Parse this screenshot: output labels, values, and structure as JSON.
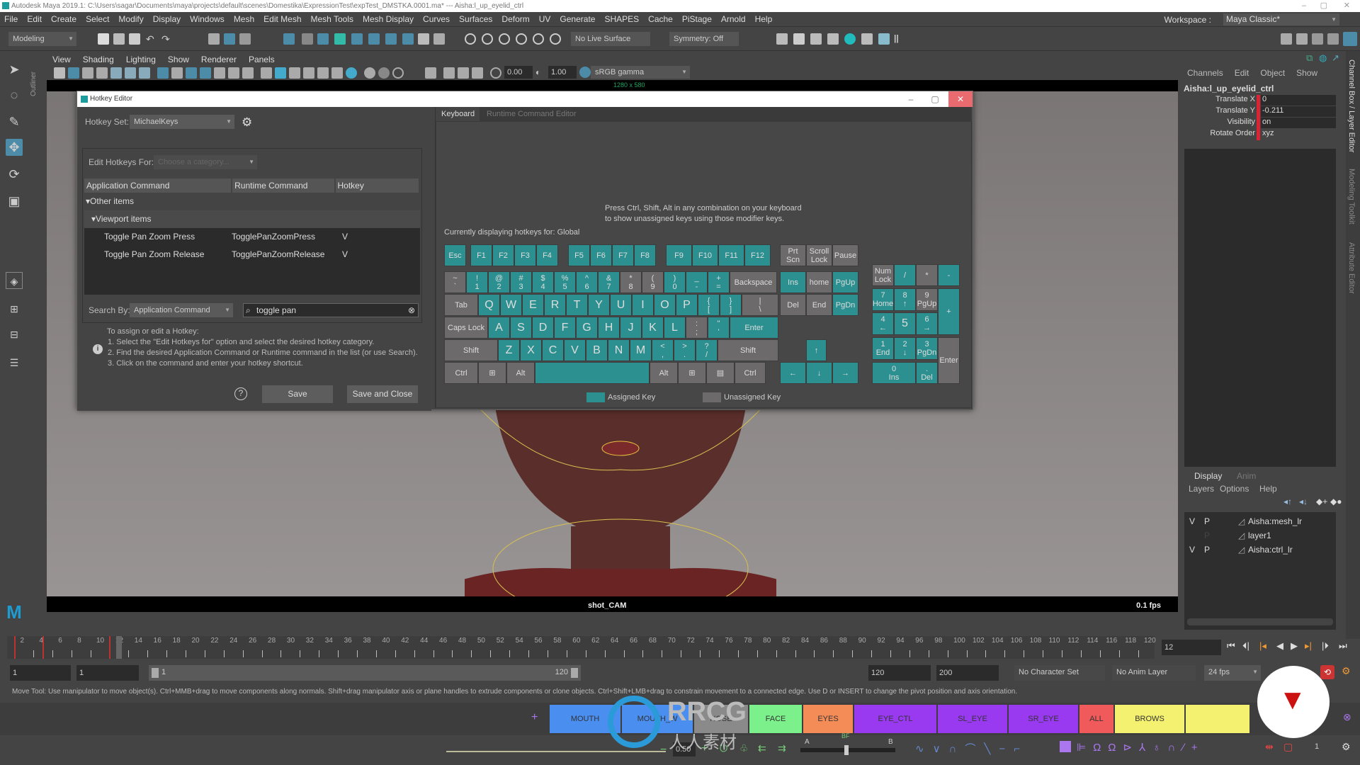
{
  "window": {
    "title": "Autodesk Maya 2019.1: C:\\Users\\sagar\\Documents\\maya\\projects\\default\\scenes\\Domestika\\ExpressionTest\\expTest_DMSTKA.0001.ma*   ---   Aisha:l_up_eyelid_ctrl",
    "controls": {
      "minimize": "–",
      "maximize": "▢",
      "close": "✕"
    }
  },
  "menubar": [
    "File",
    "Edit",
    "Create",
    "Select",
    "Modify",
    "Display",
    "Windows",
    "Mesh",
    "Edit Mesh",
    "Mesh Tools",
    "Mesh Display",
    "Curves",
    "Surfaces",
    "Deform",
    "UV",
    "Generate",
    "SHAPES",
    "Cache",
    "PiStage",
    "Arnold",
    "Help"
  ],
  "workspace": {
    "label": "Workspace :",
    "value": "Maya Classic*"
  },
  "status_line": {
    "menu_set": "Modeling",
    "live_surface": "No Live Surface",
    "symmetry": "Symmetry: Off"
  },
  "outliner_tab": "Outliner",
  "viewport": {
    "menu": [
      "View",
      "Shading",
      "Lighting",
      "Show",
      "Renderer",
      "Panels"
    ],
    "exposure": "0.00",
    "gamma": "1.00",
    "color_space": "sRGB gamma",
    "resolution": "1280 x 580",
    "camera": "shot_CAM",
    "fps": "0.1 fps"
  },
  "hotkey_editor": {
    "title": "Hotkey Editor",
    "hotkey_set_label": "Hotkey Set:",
    "hotkey_set_value": "MichaelKeys",
    "edit_for_label": "Edit Hotkeys For:",
    "edit_for_placeholder": "Choose a category...",
    "columns": [
      "Application Command",
      "Runtime Command",
      "Hotkey"
    ],
    "groups": [
      "Other items",
      "Viewport items"
    ],
    "rows": [
      {
        "app": "Toggle Pan Zoom Press",
        "runtime": "TogglePanZoomPress",
        "hotkey": "V"
      },
      {
        "app": "Toggle Pan Zoom Release",
        "runtime": "TogglePanZoomRelease",
        "hotkey": "V"
      }
    ],
    "search_by_label": "Search By:",
    "search_by_value": "Application Command",
    "search_text": "toggle pan",
    "info": [
      "To assign or edit a Hotkey:",
      "1. Select the \"Edit Hotkeys for\" option and select the desired hotkey category.",
      "2. Find the desired Application Command or Runtime command in the list (or use Search).",
      "3. Click on the command and enter your hotkey shortcut."
    ],
    "help": "?",
    "save": "Save",
    "save_close": "Save and Close",
    "tabs": [
      "Keyboard",
      "Runtime Command Editor"
    ],
    "hint": [
      "Press Ctrl, Shift, Alt in any combination on your keyboard",
      "to show unassigned keys using those modifier keys."
    ],
    "current": "Currently displaying hotkeys for: Global",
    "legend_assigned": "Assigned Key",
    "legend_unassigned": "Unassigned Key",
    "colors": {
      "assigned": "#2c9090",
      "unassigned": "#6c6a6a"
    }
  },
  "keyboard": {
    "rows": [
      [
        [
          "Esc",
          "a"
        ],
        [
          "F1",
          "a"
        ],
        [
          "F2",
          "a"
        ],
        [
          "F3",
          "a"
        ],
        [
          "F4",
          "a"
        ],
        [
          "F5",
          "a"
        ],
        [
          "F6",
          "a"
        ],
        [
          "F7",
          "a"
        ],
        [
          "F8",
          "a"
        ],
        [
          "F9",
          "a"
        ],
        [
          "F10",
          "a"
        ],
        [
          "F11",
          "a"
        ],
        [
          "F12",
          "a"
        ]
      ],
      [
        [
          "~\n`",
          "u"
        ],
        [
          "!\n1",
          "a"
        ],
        [
          "@\n2",
          "a"
        ],
        [
          "#\n3",
          "a"
        ],
        [
          "$\n4",
          "a"
        ],
        [
          "%\n5",
          "a"
        ],
        [
          "^\n6",
          "a"
        ],
        [
          "&\n7",
          "a"
        ],
        [
          "*\n8",
          "u"
        ],
        [
          "(\n9",
          "u"
        ],
        [
          ")\n0",
          "a"
        ],
        [
          "_\n-",
          "a"
        ],
        [
          "+\n=",
          "a"
        ],
        [
          "Backspace",
          "u"
        ]
      ],
      [
        [
          "Tab",
          "u"
        ],
        [
          "Q",
          "a"
        ],
        [
          "W",
          "a"
        ],
        [
          "E",
          "a"
        ],
        [
          "R",
          "a"
        ],
        [
          "T",
          "a"
        ],
        [
          "Y",
          "a"
        ],
        [
          "U",
          "a"
        ],
        [
          "I",
          "a"
        ],
        [
          "O",
          "a"
        ],
        [
          "P",
          "a"
        ],
        [
          "{\n[",
          "a"
        ],
        [
          "}\n]",
          "a"
        ],
        [
          "|\n\\",
          "u"
        ]
      ],
      [
        [
          "Caps Lock",
          "u"
        ],
        [
          "A",
          "a"
        ],
        [
          "S",
          "a"
        ],
        [
          "D",
          "a"
        ],
        [
          "F",
          "a"
        ],
        [
          "G",
          "a"
        ],
        [
          "H",
          "a"
        ],
        [
          "J",
          "a"
        ],
        [
          "K",
          "a"
        ],
        [
          "L",
          "a"
        ],
        [
          ":\n;",
          "u"
        ],
        [
          "\"\n'",
          "a"
        ],
        [
          "Enter",
          "a"
        ]
      ],
      [
        [
          "Shift",
          "u"
        ],
        [
          "Z",
          "a"
        ],
        [
          "X",
          "a"
        ],
        [
          "C",
          "a"
        ],
        [
          "V",
          "a"
        ],
        [
          "B",
          "a"
        ],
        [
          "N",
          "a"
        ],
        [
          "M",
          "a"
        ],
        [
          "<\n,",
          "a"
        ],
        [
          ">\n.",
          "a"
        ],
        [
          "?\n/",
          "a"
        ],
        [
          "Shift",
          "u"
        ]
      ],
      [
        [
          "Ctrl",
          "u"
        ],
        [
          "⊞",
          "u"
        ],
        [
          "Alt",
          "u"
        ],
        [
          "",
          "a"
        ],
        [
          "Alt",
          "u"
        ],
        [
          "⊞",
          "u"
        ],
        [
          "▤",
          "u"
        ],
        [
          "Ctrl",
          "u"
        ]
      ]
    ],
    "nav": [
      [
        "Prt\nScn",
        "u"
      ],
      [
        "Scroll\nLock",
        "u"
      ],
      [
        "Pause",
        "u"
      ],
      [
        "Ins",
        "a"
      ],
      [
        "home",
        "u"
      ],
      [
        "PgUp",
        "a"
      ],
      [
        "Del",
        "u"
      ],
      [
        "End",
        "u"
      ],
      [
        "PgDn",
        "a"
      ],
      [
        "↑",
        "a"
      ],
      [
        "←",
        "a"
      ],
      [
        "↓",
        "a"
      ],
      [
        "→",
        "a"
      ]
    ],
    "numpad": [
      [
        "Num\nLock",
        "u"
      ],
      [
        "/",
        "a"
      ],
      [
        "*",
        "u"
      ],
      [
        "-",
        "a"
      ],
      [
        "7\nHome",
        "a"
      ],
      [
        "8\n↑",
        "a"
      ],
      [
        "9\nPgUp",
        "u"
      ],
      [
        "+",
        "a"
      ],
      [
        "4\n←",
        "a"
      ],
      [
        "5",
        "a"
      ],
      [
        "6\n→",
        "a"
      ],
      [
        "1\nEnd",
        "a"
      ],
      [
        "2\n↓",
        "a"
      ],
      [
        "3\nPgDn",
        "a"
      ],
      [
        "Enter",
        "u"
      ],
      [
        "0\nIns",
        "a"
      ],
      [
        ".\nDel",
        "a"
      ]
    ]
  },
  "channel_box": {
    "menu": [
      "Channels",
      "Edit",
      "Object",
      "Show"
    ],
    "object": "Aisha:l_up_eyelid_ctrl",
    "attributes": [
      {
        "name": "Translate X",
        "value": "0"
      },
      {
        "name": "Translate Y",
        "value": "-0.211"
      },
      {
        "name": "Visibility",
        "value": "on"
      },
      {
        "name": "Rotate Order",
        "value": "xyz"
      }
    ]
  },
  "layer_editor": {
    "tabs": [
      "Display",
      "Anim"
    ],
    "menu": [
      "Layers",
      "Options",
      "Help"
    ],
    "layers": [
      {
        "v": "V",
        "p": "P",
        "name": "Aisha:mesh_lr"
      },
      {
        "v": "",
        "p": "P",
        "name": "layer1"
      },
      {
        "v": "V",
        "p": "P",
        "name": "Aisha:ctrl_lr"
      }
    ]
  },
  "side_tabs": [
    "Channel Box / Layer Editor",
    "Modeling Toolkit",
    "Attribute Editor"
  ],
  "timeline": {
    "start": 1,
    "end": 120,
    "current_frame": "12",
    "labels": [
      "2",
      "4",
      "6",
      "8",
      "10",
      "12",
      "14",
      "16",
      "18",
      "20",
      "22",
      "24",
      "26",
      "28",
      "30",
      "32",
      "34",
      "36",
      "38",
      "40",
      "42",
      "44",
      "46",
      "48",
      "50",
      "52",
      "54",
      "56",
      "58",
      "60",
      "62",
      "64",
      "66",
      "68",
      "70",
      "72",
      "74",
      "76",
      "78",
      "80",
      "82",
      "84",
      "86",
      "88",
      "90",
      "92",
      "94",
      "96",
      "98",
      "100",
      "102",
      "104",
      "106",
      "108",
      "110",
      "112",
      "114",
      "116",
      "118",
      "120"
    ]
  },
  "range": {
    "start": "1",
    "anim_start": "1",
    "slider_start": "1",
    "slider_end": "120",
    "anim_end": "120",
    "end": "200",
    "character_set": "No Character Set",
    "anim_layer": "No Anim Layer",
    "fps": "24 fps"
  },
  "help_line": "Move Tool: Use manipulator to move object(s). Ctrl+MMB+drag to move components along normals. Shift+drag manipulator axis or plane handles to extrude components or clone objects. Ctrl+Shift+LMB+drag to constrain movement to a connected edge. Use D or INSERT to change the pivot position and axis orientation.",
  "shelf": [
    {
      "label": "MOUTH",
      "color": "#4a8ef0"
    },
    {
      "label": "MOUTH_W",
      "color": "#4a8ef0"
    },
    {
      "label": "NOSE",
      "color": "#8a8a8a"
    },
    {
      "label": "FACE",
      "color": "#7cf08a"
    },
    {
      "label": "EYES",
      "color": "#f48c58"
    },
    {
      "label": "EYE_CTL",
      "color": "#9a3af0"
    },
    {
      "label": "SL_EYE",
      "color": "#9a3af0"
    },
    {
      "label": "SR_EYE",
      "color": "#9a3af0"
    },
    {
      "label": "ALL",
      "color": "#f05a5a"
    },
    {
      "label": "BROWS",
      "color": "#f4f070"
    },
    {
      "label": "",
      "color": "#f4f070"
    }
  ],
  "bottom_bar": {
    "weight": "0.50",
    "slider_a": "A",
    "slider_bf": "BF",
    "slider_b": "B",
    "count": "1"
  },
  "watermark": {
    "text": "RRCG",
    "sub": "人人素材"
  }
}
